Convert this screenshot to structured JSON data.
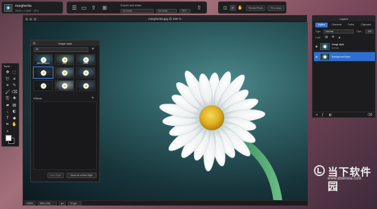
{
  "document": {
    "name": "margherita",
    "size_info": "2000 x 1,600  ·  JPG",
    "window_title": "margherita.jpg @ 100 %"
  },
  "top_toolbar": {
    "export_label": "Export and share",
    "fields": [
      "No limits",
      "No limits",
      "JPG"
    ]
  },
  "right_toolbar": {
    "buttons": [
      "Reveal Photo",
      "Fit to Area"
    ]
  },
  "image_style_panel": {
    "title": "Image style",
    "dropdown_value": "All",
    "thumbnails": [
      {
        "label": "Auto Enhance",
        "color": "#3a6b82"
      },
      {
        "label": "Fuji",
        "color": "#5a7a6a"
      },
      {
        "label": "Dusk",
        "color": "#4e6f7e"
      },
      {
        "label": "",
        "color": "#2a3e4a"
      },
      {
        "label": "",
        "color": "#6a7c84"
      },
      {
        "label": "",
        "color": "#456070"
      },
      {
        "label": "",
        "color": "#1a2a34"
      },
      {
        "label": "",
        "color": "#8a9aa2"
      },
      {
        "label": "",
        "color": "#3d5564"
      }
    ],
    "effects_label": "Effects",
    "buttons": [
      "Save Style",
      "Save As a New Style"
    ]
  },
  "tools_panel": {
    "title": "Tools",
    "icons": [
      "move-icon",
      "selection-icon",
      "lasso-icon",
      "magic-wand-icon",
      "crop-icon",
      "eyedropper-icon",
      "brush-icon",
      "eraser-icon",
      "clone-icon",
      "heal-icon",
      "fill-icon",
      "gradient-icon",
      "blur-icon",
      "dodge-icon",
      "text-icon",
      "shape-icon",
      "pen-icon",
      "hand-icon",
      "zoom-icon"
    ]
  },
  "layers_panel": {
    "title": "Layers",
    "tabs": [
      "Layers",
      "Channels",
      "Paths",
      "Clipboard"
    ],
    "active_tab": "Layers",
    "blend_label": "Type",
    "blend_mode": "Normal",
    "opacity_label": "Opa...",
    "opacity": "100",
    "lock_label": "Lock",
    "layers": [
      {
        "name": "Image style",
        "sub": "Normal",
        "selected": false
      },
      {
        "name": "Background layer",
        "sub": "",
        "selected": true
      }
    ]
  },
  "statusbar": {
    "zoom": "100%",
    "dimensions": "900 x 618",
    "units": "px",
    "resolution": "72 ppi"
  },
  "watermark": {
    "cn_text": "当下软件园",
    "url": "www.downxia.com"
  }
}
